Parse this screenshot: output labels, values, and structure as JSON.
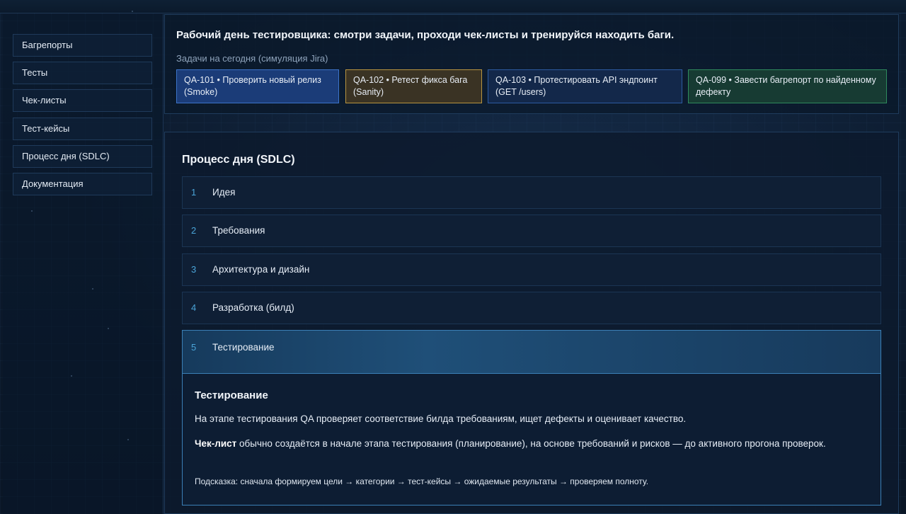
{
  "sidebar": {
    "items": [
      {
        "label": "Багрепорты"
      },
      {
        "label": "Тесты"
      },
      {
        "label": "Чек-листы"
      },
      {
        "label": "Тест-кейсы"
      },
      {
        "label": "Процесс дня (SDLC)"
      },
      {
        "label": "Документация"
      }
    ]
  },
  "header": {
    "title": "Рабочий день тестировщика: смотри задачи, проходи чек-листы и тренируйся находить баги.",
    "subtitle": "Задачи на сегодня (симуляция Jira)",
    "tasks": [
      {
        "label": "QA-101 • Проверить новый релиз (Smoke)",
        "color": "#1b3c78"
      },
      {
        "label": "QA-102 • Ретест фикса бага (Sanity)",
        "color": "#3a3324"
      },
      {
        "label": "QA-103 • Протестировать API эндпоинт (GET /users)",
        "color": "#13284a"
      },
      {
        "label": "QA-099 • Завести багрепорт по найденному дефекту",
        "color": "#173b33"
      }
    ]
  },
  "main": {
    "title": "Процесс дня (SDLC)",
    "steps": [
      {
        "num": "1",
        "label": "Идея"
      },
      {
        "num": "2",
        "label": "Требования"
      },
      {
        "num": "3",
        "label": "Архитектура и дизайн"
      },
      {
        "num": "4",
        "label": "Разработка (билд)"
      },
      {
        "num": "5",
        "label": "Тестирование"
      }
    ],
    "detail": {
      "title": "Тестирование",
      "p1": "На этапе тестирования QA проверяет соответствие билда требованиям, ищет дефекты и оценивает качество.",
      "p2_bold": "Чек-лист",
      "p2_rest": " обычно создаётся в начале этапа тестирования (планирование), на основе требований и рисков — до активного прогона проверок.",
      "hint": "Подсказка: сначала формируем цели → категории → тест-кейсы → ожидаемые результаты → проверяем полноту."
    }
  }
}
